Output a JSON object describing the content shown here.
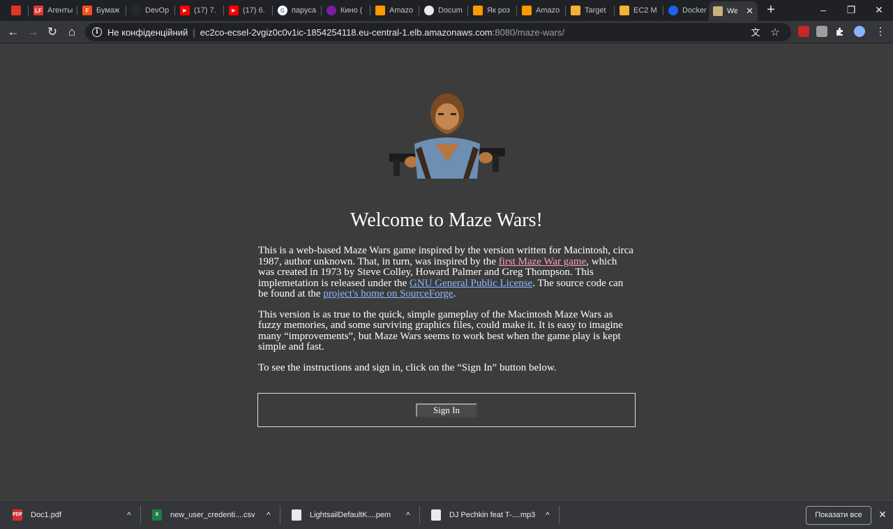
{
  "browser": {
    "tabs": [
      {
        "title": "",
        "icon": "aliexpress-icon",
        "color": "#e43225"
      },
      {
        "title": "Агенты",
        "icon": "lf-icon",
        "color": "#e53935"
      },
      {
        "title": "Бумаж",
        "icon": "f-icon",
        "color": "#f4511e"
      },
      {
        "title": "DevOp",
        "icon": "github-icon",
        "color": "#24292e"
      },
      {
        "title": "(17) 7.",
        "icon": "youtube-icon",
        "color": "#ff0000"
      },
      {
        "title": "(17) 6.",
        "icon": "youtube-icon",
        "color": "#ff0000"
      },
      {
        "title": "паруса",
        "icon": "google-icon",
        "color": "#ffffff"
      },
      {
        "title": "Кино (",
        "icon": "kino-icon",
        "color": "#7b1fa2"
      },
      {
        "title": "Amazo",
        "icon": "aws-icon",
        "color": "#ff9900"
      },
      {
        "title": "Docum",
        "icon": "globe-icon",
        "color": "#e8eaed"
      },
      {
        "title": "Як роз",
        "icon": "aws-icon",
        "color": "#ff9900"
      },
      {
        "title": "Amazo",
        "icon": "aws-icon",
        "color": "#ff9900"
      },
      {
        "title": "Target",
        "icon": "box-icon",
        "color": "#f2b233"
      },
      {
        "title": "EC2 M",
        "icon": "box-icon",
        "color": "#f2b233"
      },
      {
        "title": "Docker",
        "icon": "docker-icon",
        "color": "#1d63ed"
      },
      {
        "title": "Wel",
        "icon": "maze-icon",
        "color": "#c9b27c",
        "active": true,
        "close": "✕"
      }
    ],
    "new_tab": "+",
    "window_controls": {
      "minimize": "–",
      "restore": "❐",
      "close": "✕"
    },
    "nav": {
      "back": "←",
      "forward": "→",
      "reload": "↻",
      "home": "⌂"
    },
    "address": {
      "security_label": "Не конфіденційний",
      "separator": "|",
      "host": "ec2co-ecsel-2vgiz0c0v1ic-1854254118.eu-central-1.elb.amazonaws.com",
      "rest": ":8080/maze-wars/"
    },
    "omnibox_icons": {
      "translate": "文",
      "bookmark": "☆"
    },
    "extension_colors": [
      "#c62828",
      "#9e9e9e",
      "#e8eaed",
      "#8ab4f8"
    ],
    "menu": "⋮"
  },
  "page": {
    "title": "Welcome to Maze Wars!",
    "para1": {
      "t1": "This is a web-based Maze Wars game inspired by the version written for Macintosh, circa 1987, author unknown. That, in turn, was inspired by the ",
      "link1": "first Maze War game",
      "t2": ", which was created in 1973 by Steve Colley, Howard Palmer and Greg Thompson. This implemetation is released under the ",
      "link2": "GNU General Public License",
      "t3": ". The source code can be found at the ",
      "link3": "project's home on SourceForge",
      "t4": "."
    },
    "para2": "This version is as true to the quick, simple gameplay of the Macintosh Maze Wars as fuzzy memories, and some surviving graphics files, could make it. It is easy to imagine many “improvements”, but Maze Wars seems to work best when the game play is kept simple and fast.",
    "para3": "To see the instructions and sign in, click on the “Sign In” button below.",
    "signin_label": "Sign In"
  },
  "downloads": {
    "items": [
      {
        "name": "Doc1.pdf",
        "icon": "pdf-file-icon",
        "color": "#d32f2f",
        "badge": "PDF"
      },
      {
        "name": "new_user_credenti....csv",
        "icon": "csv-file-icon",
        "color": "#1e7e45",
        "badge": "X"
      },
      {
        "name": "LightsailDefaultK....pem",
        "icon": "file-icon",
        "color": "#e8eaed",
        "badge": ""
      },
      {
        "name": "DJ Pechkin feat T-....mp3",
        "icon": "audio-file-icon",
        "color": "#e8eaed",
        "badge": ""
      }
    ],
    "chevron": "^",
    "show_all": "Показати все",
    "close": "✕"
  }
}
